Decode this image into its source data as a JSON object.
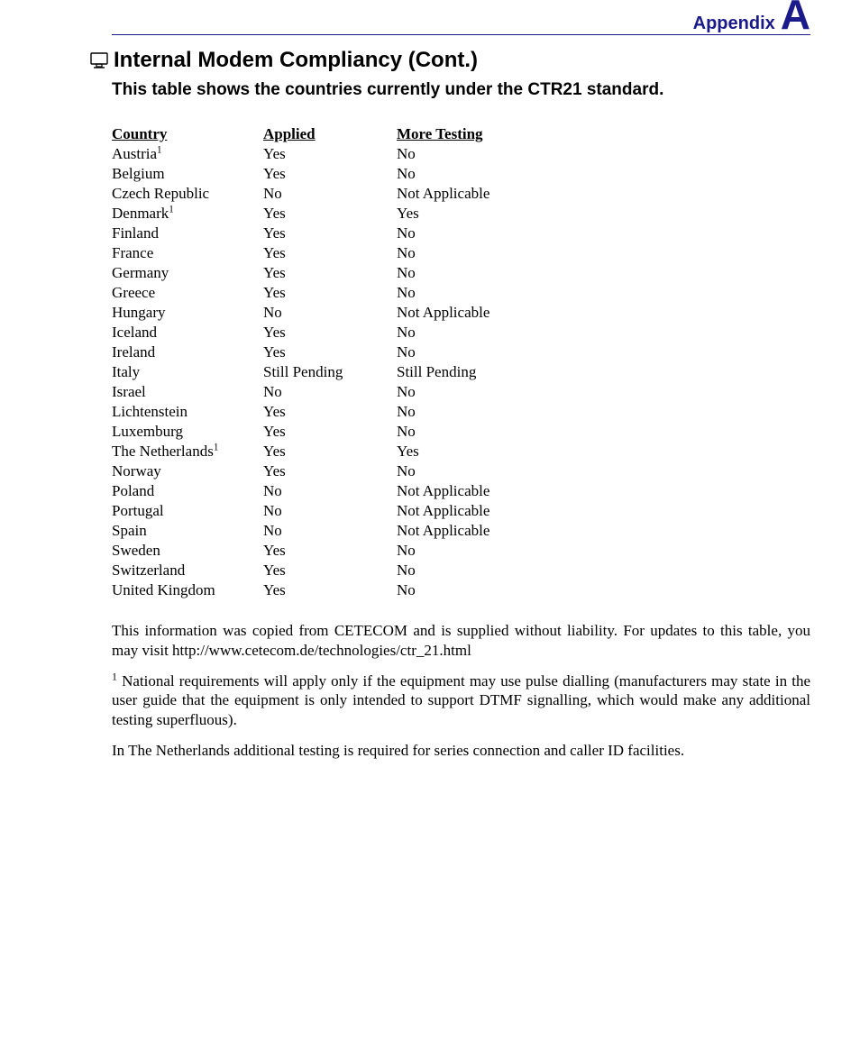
{
  "header": {
    "appendix_word": "Appendix",
    "appendix_letter": "A"
  },
  "title": "Internal Modem Compliancy (Cont.)",
  "subtitle": "This table shows the countries currently under the CTR21 standard.",
  "table": {
    "headers": {
      "country": "Country",
      "applied": "Applied",
      "more": "More Testing"
    },
    "rows": [
      {
        "country": "Austria",
        "sup": "1",
        "applied": "Yes",
        "more": "No"
      },
      {
        "country": "Belgium",
        "applied": "Yes",
        "more": "No"
      },
      {
        "country": "Czech Republic",
        "applied": "No",
        "more": "Not Applicable"
      },
      {
        "country": "Denmark",
        "sup": "1",
        "applied": "Yes",
        "more": "Yes"
      },
      {
        "country": "Finland",
        "applied": "Yes",
        "more": "No"
      },
      {
        "country": "France",
        "applied": "Yes",
        "more": "No"
      },
      {
        "country": "Germany",
        "applied": "Yes",
        "more": "No"
      },
      {
        "country": "Greece",
        "applied": "Yes",
        "more": "No"
      },
      {
        "country": "Hungary",
        "applied": "No",
        "more": "Not Applicable"
      },
      {
        "country": "Iceland",
        "applied": "Yes",
        "more": "No"
      },
      {
        "country": "Ireland",
        "applied": "Yes",
        "more": "No"
      },
      {
        "country": "Italy",
        "applied": "Still Pending",
        "more": "Still Pending"
      },
      {
        "country": "Israel",
        "applied": "No",
        "more": "No"
      },
      {
        "country": "Lichtenstein",
        "applied": "Yes",
        "more": "No"
      },
      {
        "country": "Luxemburg",
        "applied": "Yes",
        "more": "No"
      },
      {
        "country": "The Netherlands",
        "sup": "1",
        "applied": "Yes",
        "more": "Yes"
      },
      {
        "country": "Norway",
        "applied": "Yes",
        "more": "No"
      },
      {
        "country": "Poland",
        "applied": "No",
        "more": "Not Applicable"
      },
      {
        "country": "Portugal",
        "applied": "No",
        "more": "Not Applicable"
      },
      {
        "country": "Spain",
        "applied": "No",
        "more": "Not Applicable"
      },
      {
        "country": "Sweden",
        "applied": "Yes",
        "more": "No"
      },
      {
        "country": "Switzerland",
        "applied": "Yes",
        "more": "No"
      },
      {
        "country": "United Kingdom",
        "applied": "Yes",
        "more": "No"
      }
    ]
  },
  "paragraphs": {
    "p1": "This information was copied from CETECOM and is supplied without liability. For updates to this table, you may visit http://www.cetecom.de/technologies/ctr_21.html",
    "p2_mark": "1",
    "p2": " National requirements will apply only if the equipment may use pulse dialling (manufacturers may state in the user guide that the equipment is only intended to support DTMF signalling, which would make any additional testing superfluous).",
    "p3": "In The Netherlands additional testing is required for series connection and caller ID facilities."
  }
}
